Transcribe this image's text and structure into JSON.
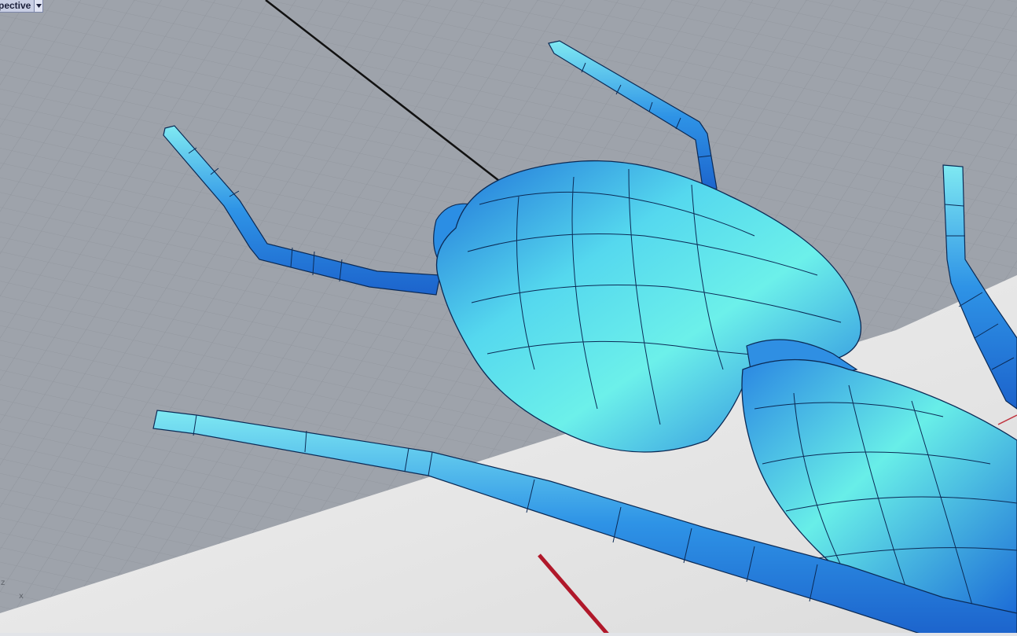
{
  "viewport": {
    "title": "pective",
    "dropdown_icon": "chevron-down-icon",
    "axis": {
      "z_label": "z",
      "x_label": "x"
    }
  },
  "colors": {
    "grid_background": "#9ea3ab",
    "grid_line": "#8c9199",
    "model_blue": "#2f95e6",
    "model_cyan": "#5fe8e8",
    "ground_plane": "#ececec",
    "axis_red": "#b0182a",
    "tab_background": "#c9cfe4"
  }
}
